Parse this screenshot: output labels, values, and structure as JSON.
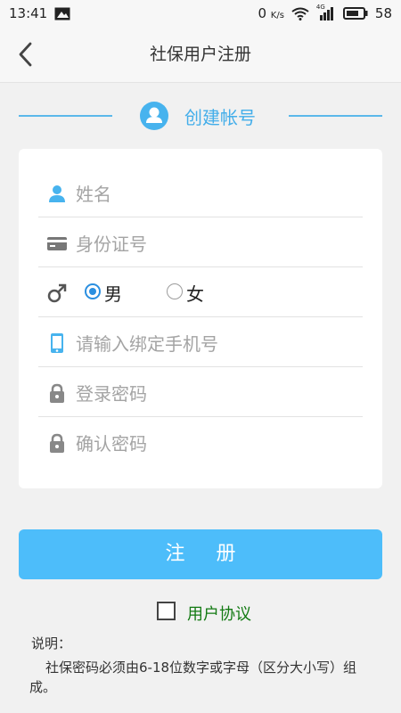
{
  "status_bar": {
    "time": "13:41",
    "net_speed": "0",
    "net_unit": "K/s",
    "signal_label": "4G",
    "battery": "58"
  },
  "header": {
    "title": "社保用户注册"
  },
  "section": {
    "title": "创建帐号"
  },
  "form": {
    "name_placeholder": "姓名",
    "id_placeholder": "身份证号",
    "gender": {
      "male": "男",
      "female": "女",
      "selected": "男"
    },
    "phone_placeholder": "请输入绑定手机号",
    "password_placeholder": "登录密码",
    "confirm_placeholder": "确认密码"
  },
  "submit_label": "注 册",
  "agreement": {
    "label": "用户协议",
    "checked": false
  },
  "note": {
    "title": "说明：",
    "body": "社保密码必须由6-18位数字或字母（区分大小写）组成。"
  },
  "colors": {
    "accent": "#47b3ee",
    "button": "#4dbdfa",
    "agreement_text": "#137a13"
  }
}
